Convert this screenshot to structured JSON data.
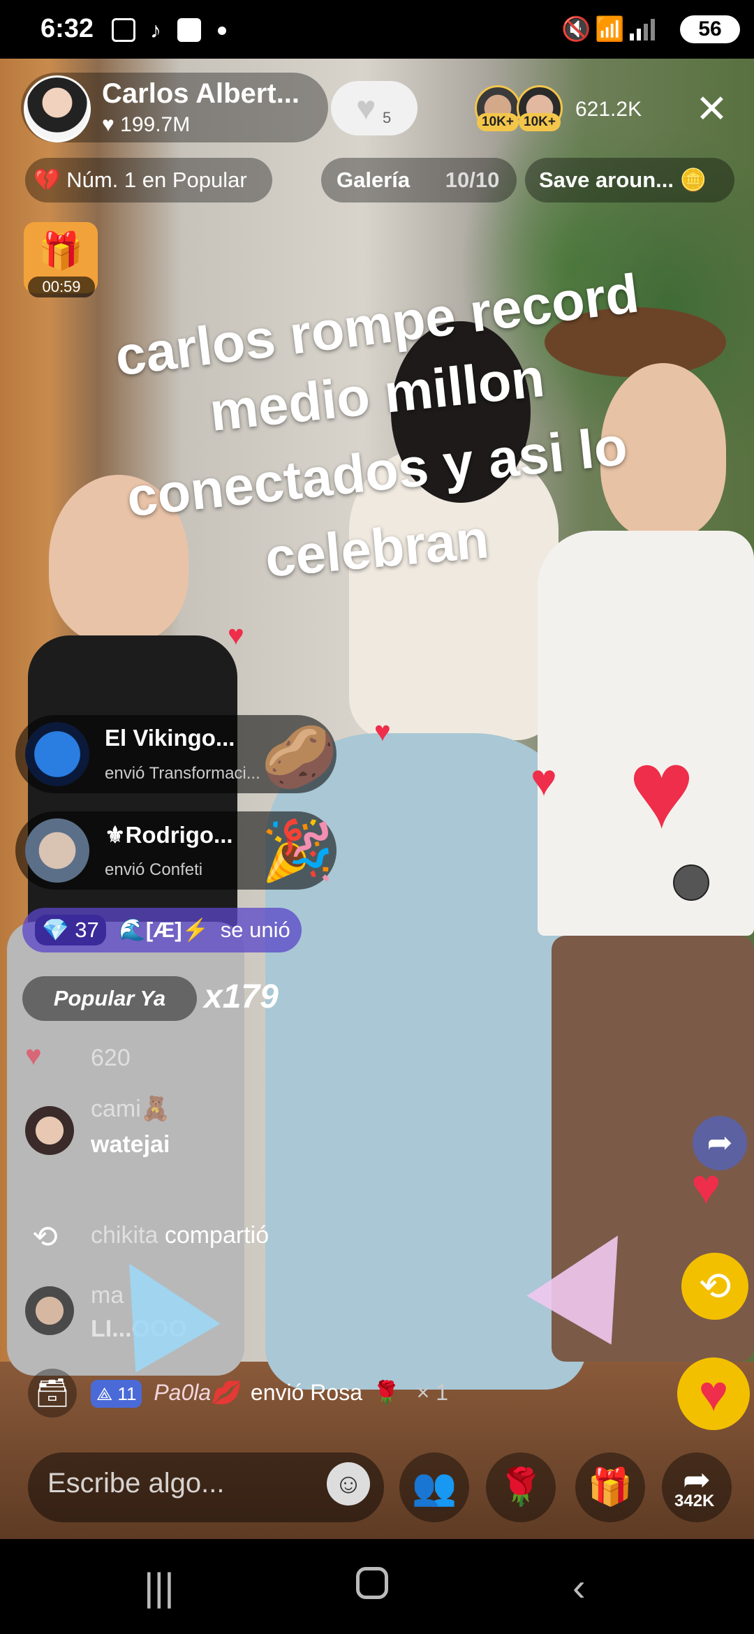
{
  "status_bar": {
    "time": "6:32",
    "icons": [
      "screenshot-icon",
      "tiktok-icon",
      "app-icon",
      "dot-icon"
    ],
    "right_icons": [
      "mute-icon",
      "wifi-icon",
      "signal-icon"
    ],
    "battery": "56"
  },
  "header": {
    "host_name": "Carlos Albert...",
    "host_likes": "199.7M",
    "follow_count": "5",
    "top_viewer_badges": [
      "10K+",
      "10K+"
    ],
    "viewer_count": "621.2K",
    "close_label": "✕"
  },
  "chips": {
    "rank": "Núm. 1 en Popular",
    "gallery_label": "Galería",
    "gallery_progress": "10/10",
    "save_label": "Save aroun...",
    "timer": "00:59"
  },
  "caption_lines": [
    "carlos rompe record",
    "medio millon",
    "conectados y asi lo",
    "celebran"
  ],
  "gift_events": [
    {
      "name": "El Vikingo...",
      "action": "envió Transformaci..."
    },
    {
      "name": "⚜Rodrigo...",
      "action": "envió Confeti"
    }
  ],
  "joined": {
    "level": "37",
    "name": "🌊[Æ]⚡",
    "action": "se unió"
  },
  "popular": {
    "label": "Popular Ya",
    "combo": "x179"
  },
  "chat": [
    {
      "user": "",
      "text": "620"
    },
    {
      "user": "cami🧸",
      "text": "watejai"
    },
    {
      "user": "chikita",
      "text": "compartió"
    },
    {
      "user": "ma",
      "text": "LI...OOO"
    }
  ],
  "rose_event": {
    "level": "11",
    "user": "Pa0la💋",
    "action": "envió Rosa",
    "emoji": "🌹",
    "count": "× 1"
  },
  "bottom_bar": {
    "placeholder": "Escribe algo...",
    "share_count": "342K"
  },
  "colors": {
    "accent_red": "#ee2e4a",
    "gold": "#f3c64b",
    "join_purple": "#5a46c8"
  }
}
